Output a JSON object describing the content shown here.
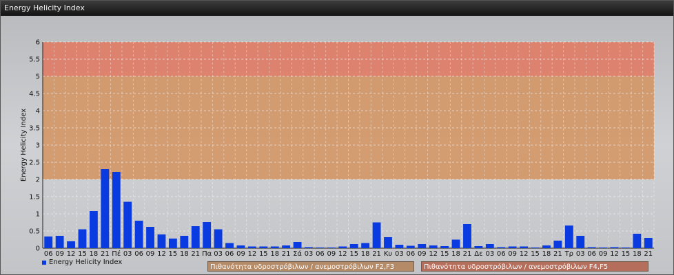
{
  "window": {
    "title": "Energy Helicity Index"
  },
  "chart_data": {
    "type": "bar",
    "ylabel": "Energy Helicity Index",
    "ylim": [
      0,
      6
    ],
    "yticks": [
      "0",
      "0.5",
      "1",
      "1.5",
      "2",
      "2.5",
      "3",
      "3.5",
      "4",
      "4.5",
      "5",
      "5.5",
      "6"
    ],
    "grid": true,
    "categories": [
      "06",
      "09",
      "12",
      "15",
      "18",
      "21",
      "Πέ",
      "03",
      "06",
      "09",
      "12",
      "15",
      "18",
      "21",
      "Πα",
      "03",
      "06",
      "09",
      "12",
      "15",
      "18",
      "21",
      "Σά",
      "03",
      "06",
      "09",
      "12",
      "15",
      "18",
      "21",
      "Κυ",
      "03",
      "06",
      "09",
      "12",
      "15",
      "18",
      "21",
      "Δε",
      "03",
      "06",
      "09",
      "12",
      "15",
      "18",
      "21",
      "Τρ",
      "03",
      "06",
      "09",
      "12",
      "15",
      "18",
      "21"
    ],
    "series": [
      {
        "name": "Energy Helicity Index",
        "color": "#0a3be0",
        "values": [
          0.34,
          0.36,
          0.2,
          0.55,
          1.08,
          2.3,
          2.22,
          1.35,
          0.8,
          0.62,
          0.4,
          0.28,
          0.36,
          0.64,
          0.76,
          0.55,
          0.15,
          0.08,
          0.05,
          0.05,
          0.05,
          0.08,
          0.18,
          0.03,
          0.02,
          0.02,
          0.05,
          0.12,
          0.15,
          0.75,
          0.32,
          0.1,
          0.07,
          0.12,
          0.08,
          0.06,
          0.25,
          0.7,
          0.06,
          0.12,
          0.03,
          0.05,
          0.05,
          0.02,
          0.08,
          0.22,
          0.66,
          0.36,
          0.03,
          0.02,
          0.03,
          0.02,
          0.42,
          0.3
        ]
      }
    ],
    "bands": [
      {
        "from": 2,
        "to": 5,
        "color": "#d4935f",
        "label": "Πιθανότητα υδροστρόβιλων / ανεμοστρόβιλων F2,F3"
      },
      {
        "from": 5,
        "to": 6,
        "color": "#e2775e",
        "label": "Πιθανότητα υδροστρόβιλων / ανεμοστρόβιλων F4,F5"
      }
    ],
    "legend_position": "bottom-left"
  }
}
